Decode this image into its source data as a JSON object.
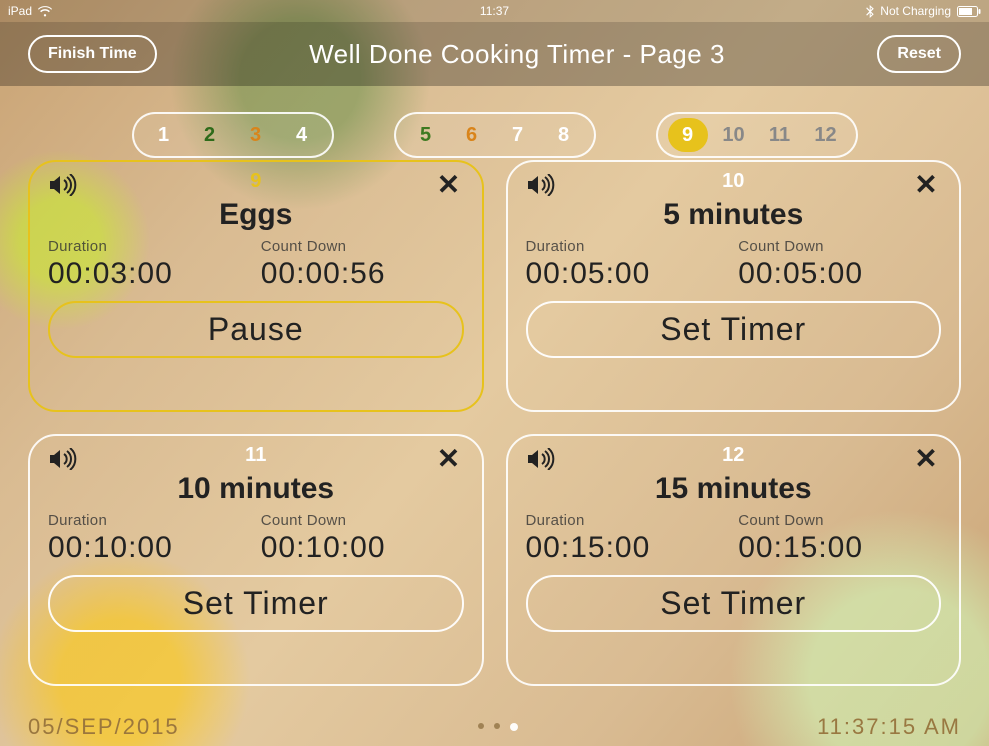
{
  "status_bar": {
    "carrier": "iPad",
    "wifi_icon": "wifi",
    "time": "11:37",
    "bt_icon": "bluetooth",
    "charge_text": "Not Charging",
    "battery_icon": "battery"
  },
  "header": {
    "left_button": "Finish Time",
    "title": "Well Done Cooking Timer - Page 3",
    "right_button": "Reset"
  },
  "pager": {
    "groups": [
      {
        "items": [
          {
            "label": "1",
            "color": "#ffffff"
          },
          {
            "label": "2",
            "color": "#2e6b1a"
          },
          {
            "label": "3",
            "color": "#d9841a"
          },
          {
            "label": "4",
            "color": "#ffffff"
          }
        ]
      },
      {
        "items": [
          {
            "label": "5",
            "color": "#3d7a20"
          },
          {
            "label": "6",
            "color": "#d9841a"
          },
          {
            "label": "7",
            "color": "#ffffff"
          },
          {
            "label": "8",
            "color": "#ffffff"
          }
        ]
      },
      {
        "items": [
          {
            "label": "9",
            "color": "#ffffff",
            "active": true
          },
          {
            "label": "10",
            "color": "#888888"
          },
          {
            "label": "11",
            "color": "#888888"
          },
          {
            "label": "12",
            "color": "#888888"
          }
        ]
      }
    ]
  },
  "labels": {
    "duration": "Duration",
    "countdown": "Count Down"
  },
  "cards": [
    {
      "id": "9",
      "id_class": "gold",
      "active": true,
      "name": "Eggs",
      "duration": "00:03:00",
      "countdown": "00:00:56",
      "action": "Pause"
    },
    {
      "id": "10",
      "id_class": "white",
      "active": false,
      "name": "5 minutes",
      "duration": "00:05:00",
      "countdown": "00:05:00",
      "action": "Set Timer"
    },
    {
      "id": "11",
      "id_class": "white",
      "active": false,
      "name": "10 minutes",
      "duration": "00:10:00",
      "countdown": "00:10:00",
      "action": "Set Timer"
    },
    {
      "id": "12",
      "id_class": "white",
      "active": false,
      "name": "15 minutes",
      "duration": "00:15:00",
      "countdown": "00:15:00",
      "action": "Set Timer"
    }
  ],
  "footer": {
    "date": "05/SEP/2015",
    "time": "11:37:15 AM"
  }
}
